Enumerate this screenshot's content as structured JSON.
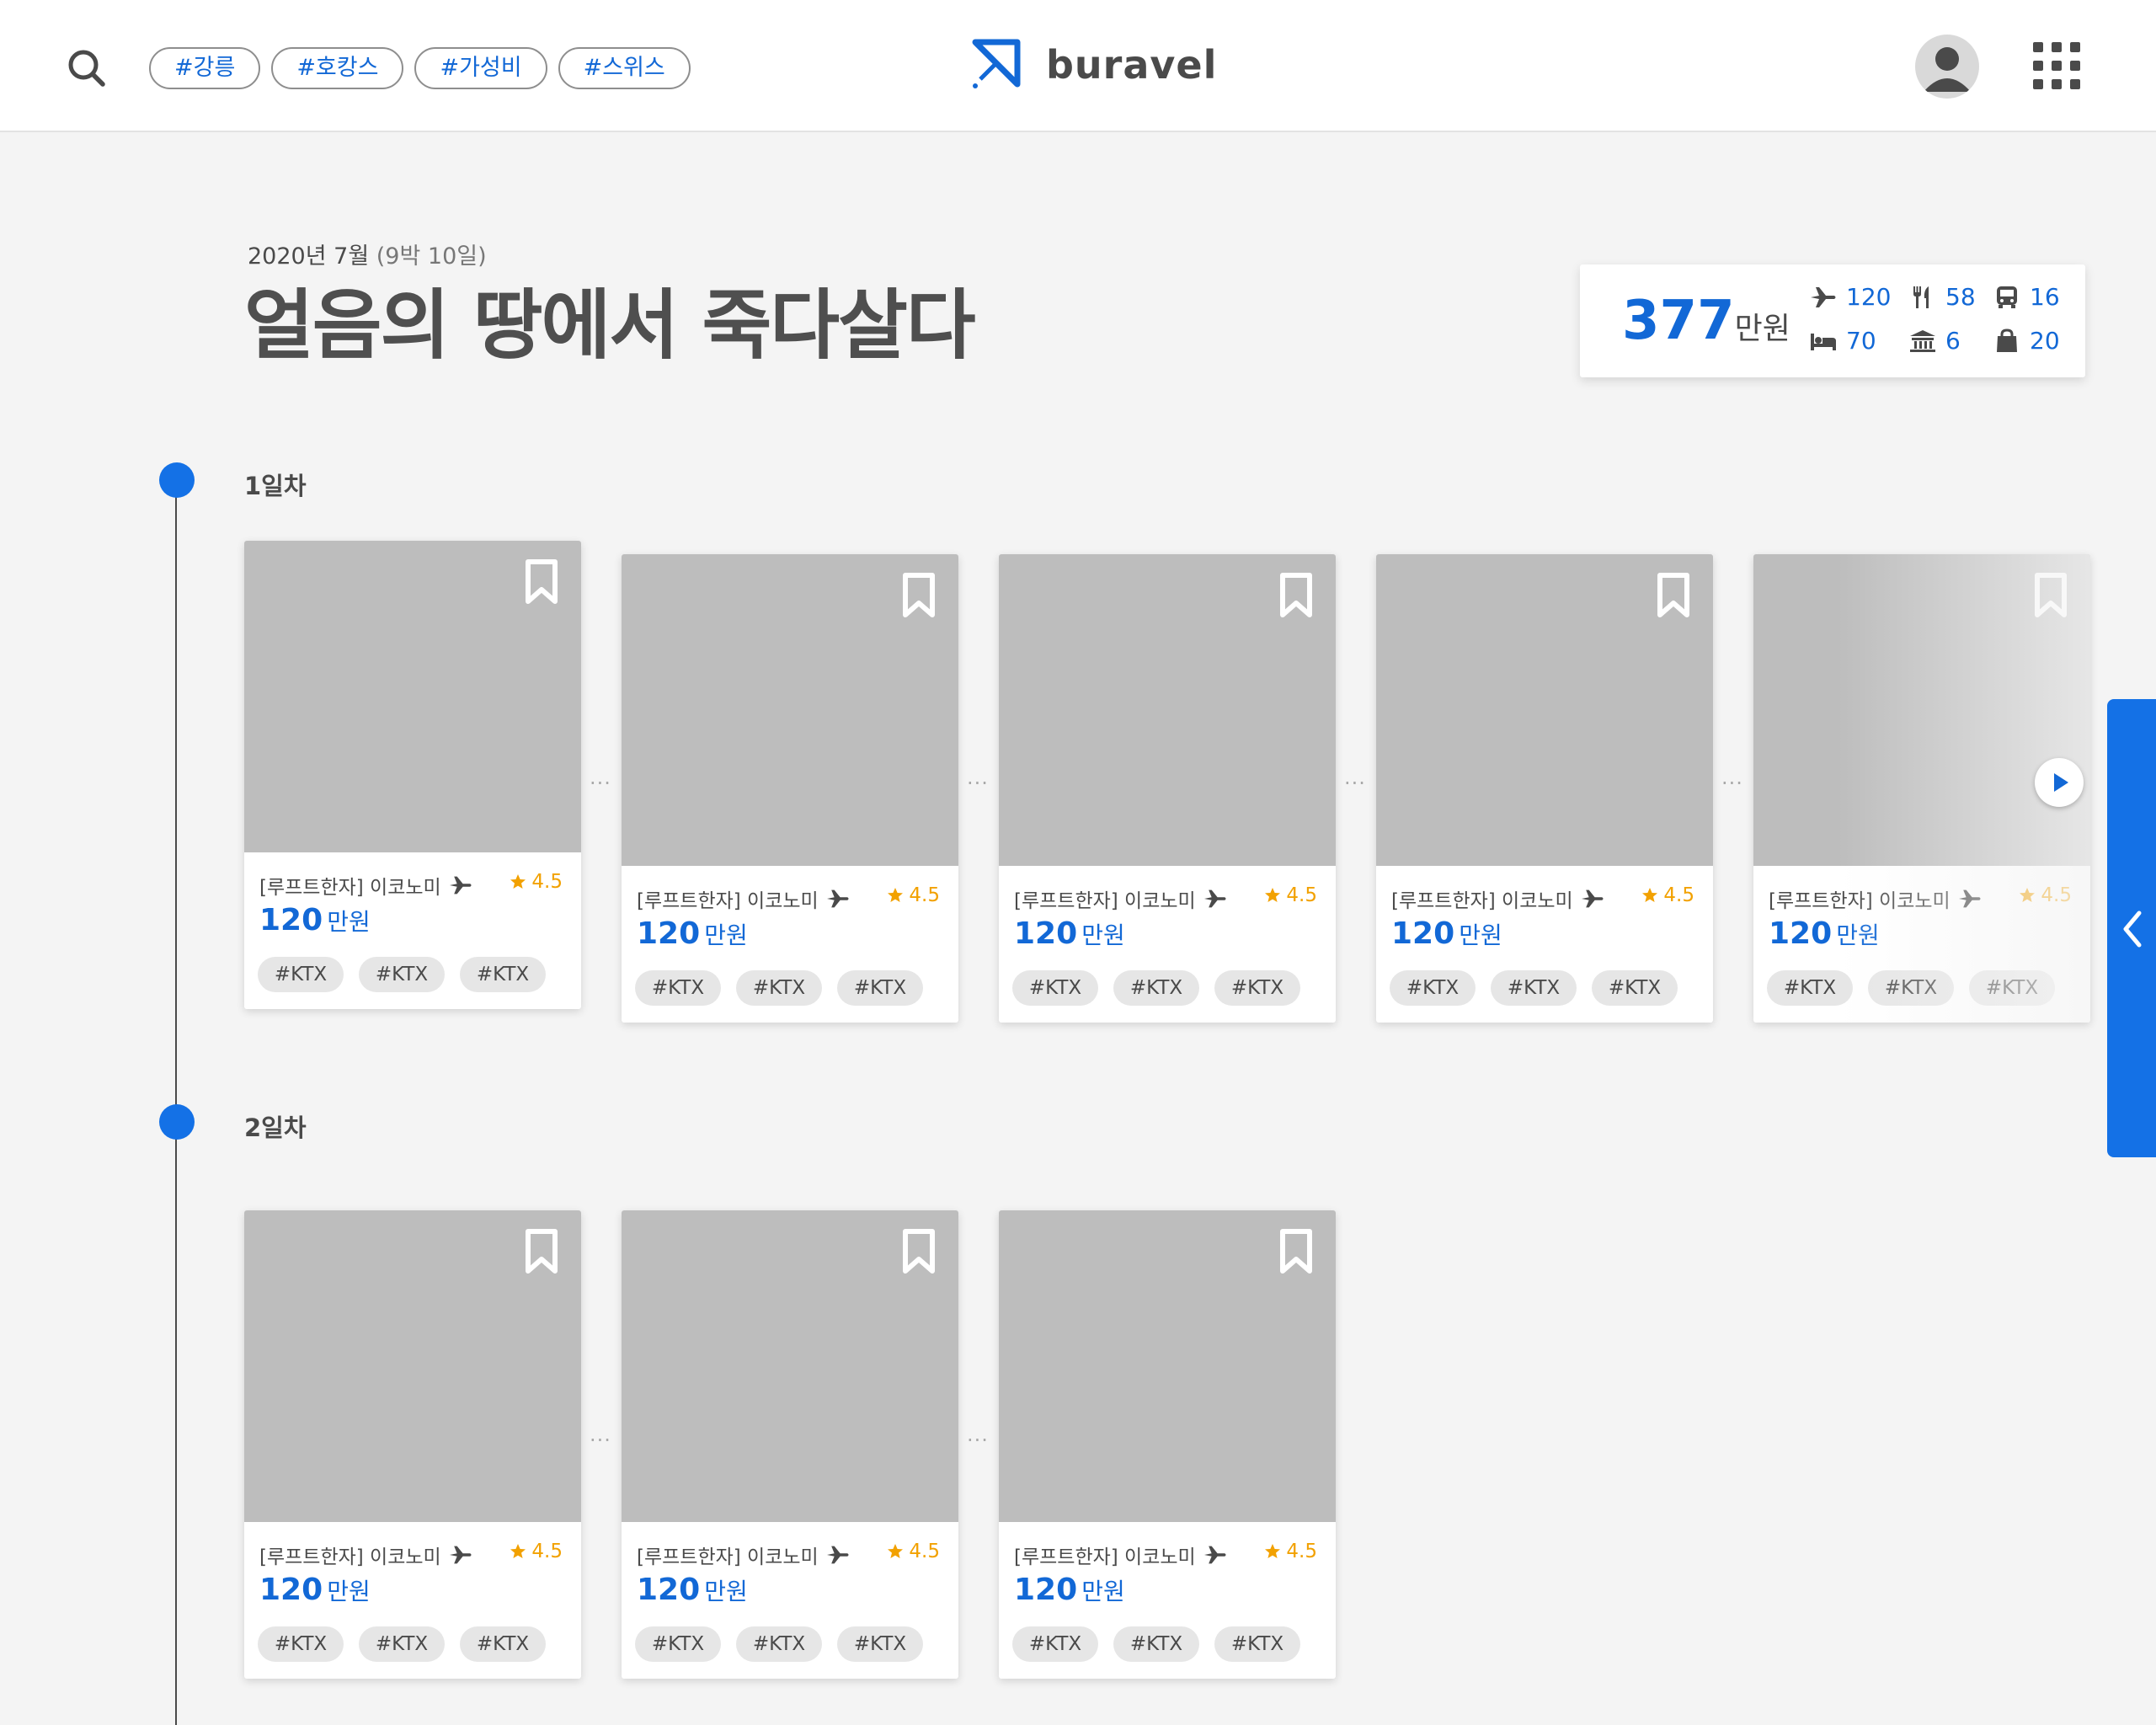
{
  "header": {
    "tags": [
      "#강릉",
      "#호캉스",
      "#가성비",
      "#스위스"
    ],
    "logo_text": "buravel"
  },
  "trip": {
    "date": "2020년 7월",
    "duration": "(9박 10일)",
    "title": "얼음의 땅에서 죽다살다"
  },
  "budget": {
    "total": "377",
    "unit": "만원",
    "items": [
      {
        "icon": "plane-icon",
        "value": "120"
      },
      {
        "icon": "fork-knife-icon",
        "value": "58"
      },
      {
        "icon": "bus-icon",
        "value": "16"
      },
      {
        "icon": "bed-icon",
        "value": "70"
      },
      {
        "icon": "museum-icon",
        "value": "6"
      },
      {
        "icon": "shopping-bag-icon",
        "value": "20"
      }
    ]
  },
  "days": [
    {
      "label": "1일차",
      "cards": [
        {
          "title": "[루프트한자] 이코노미",
          "rating": "4.5",
          "price": "120",
          "unit": "만원",
          "tags": [
            "#KTX",
            "#KTX",
            "#KTX"
          ]
        },
        {
          "title": "[루프트한자] 이코노미",
          "rating": "4.5",
          "price": "120",
          "unit": "만원",
          "tags": [
            "#KTX",
            "#KTX",
            "#KTX"
          ]
        },
        {
          "title": "[루프트한자] 이코노미",
          "rating": "4.5",
          "price": "120",
          "unit": "만원",
          "tags": [
            "#KTX",
            "#KTX",
            "#KTX"
          ]
        },
        {
          "title": "[루프트한자] 이코노미",
          "rating": "4.5",
          "price": "120",
          "unit": "만원",
          "tags": [
            "#KTX",
            "#KTX",
            "#KTX"
          ]
        },
        {
          "title": "[루프트한자] 이코노미",
          "rating": "4.5",
          "price": "120",
          "unit": "만원",
          "tags": [
            "#KTX",
            "#KTX",
            "#KTX"
          ]
        }
      ]
    },
    {
      "label": "2일차",
      "cards": [
        {
          "title": "[루프트한자] 이코노미",
          "rating": "4.5",
          "price": "120",
          "unit": "만원",
          "tags": [
            "#KTX",
            "#KTX",
            "#KTX"
          ]
        },
        {
          "title": "[루프트한자] 이코노미",
          "rating": "4.5",
          "price": "120",
          "unit": "만원",
          "tags": [
            "#KTX",
            "#KTX",
            "#KTX"
          ]
        },
        {
          "title": "[루프트한자] 이코노미",
          "rating": "4.5",
          "price": "120",
          "unit": "만원",
          "tags": [
            "#KTX",
            "#KTX",
            "#KTX"
          ]
        }
      ]
    }
  ],
  "connector": "···",
  "colors": {
    "accent": "#1268d6",
    "rating": "#f2a100",
    "tab": "#1471e6"
  }
}
